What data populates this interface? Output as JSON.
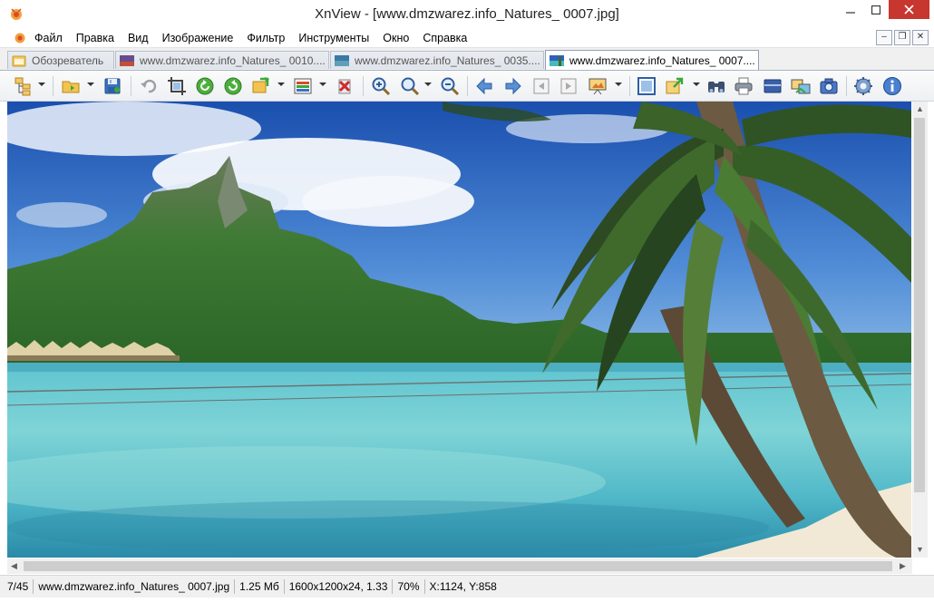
{
  "window": {
    "title": "XnView - [www.dmzwarez.info_Natures_ 0007.jpg]"
  },
  "menu": {
    "items": [
      "Файл",
      "Правка",
      "Вид",
      "Изображение",
      "Фильтр",
      "Инструменты",
      "Окно",
      "Справка"
    ]
  },
  "tabs": [
    {
      "label": "Обозреватель",
      "active": false
    },
    {
      "label": "www.dmzwarez.info_Natures_ 0010....",
      "active": false
    },
    {
      "label": "www.dmzwarez.info_Natures_ 0035....",
      "active": false
    },
    {
      "label": "www.dmzwarez.info_Natures_ 0007....",
      "active": true
    }
  ],
  "toolbar": {
    "icons": [
      "browser-icon",
      "open-folder-icon",
      "save-icon",
      "undo-icon",
      "crop-icon",
      "rotate-left-icon",
      "rotate-right-icon",
      "flip-icon",
      "adjust-icon",
      "delete-icon",
      "zoom-in-icon",
      "zoom-icon",
      "zoom-out-icon",
      "prev-icon",
      "next-icon",
      "prev-page-icon",
      "next-page-icon",
      "slideshow-icon",
      "fit-icon",
      "export-icon",
      "find-icon",
      "print-icon",
      "scanner-icon",
      "convert-icon",
      "capture-icon",
      "settings-icon",
      "info-icon"
    ]
  },
  "status": {
    "index": "7/45",
    "filename": "www.dmzwarez.info_Natures_ 0007.jpg",
    "size": "1.25 Мб",
    "dimensions": "1600x1200x24, 1.33",
    "zoom": "70%",
    "coords": "X:1124, Y:858"
  },
  "colors": {
    "close": "#c7372f",
    "accent": "#3c6ea8"
  }
}
